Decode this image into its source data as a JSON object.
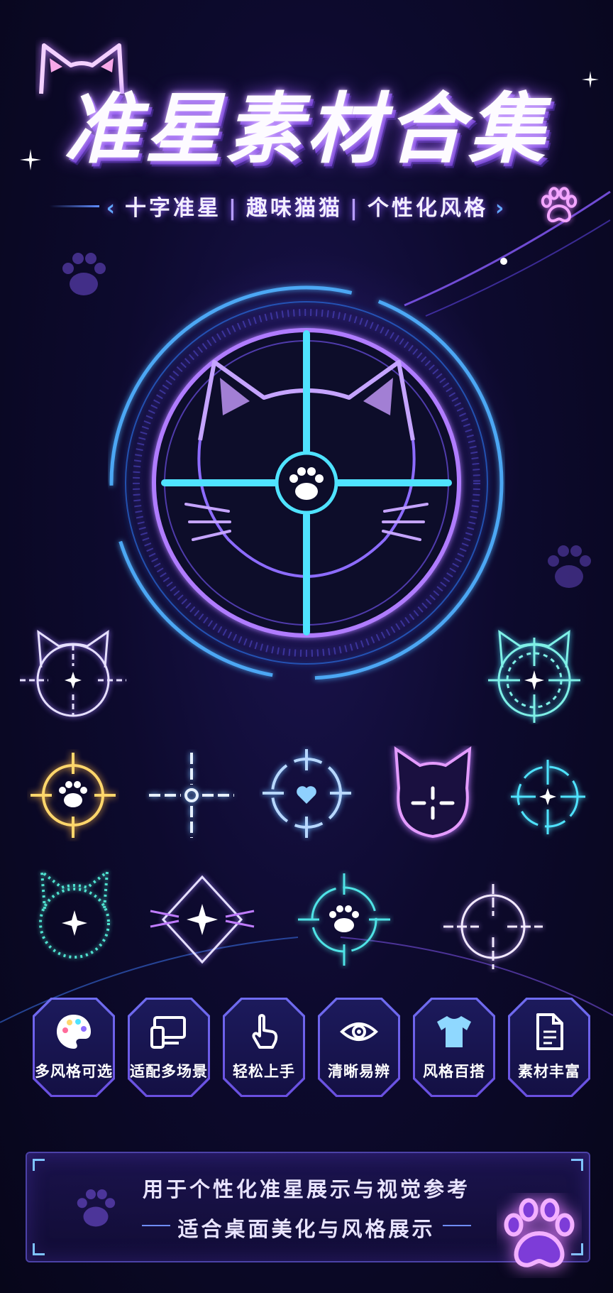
{
  "title": "准星素材合集",
  "subtitle": {
    "items": [
      "十字准星",
      "趣味猫猫",
      "个性化风格"
    ],
    "separator": "|",
    "left_arrow": "‹",
    "right_arrow": "›"
  },
  "features": [
    {
      "label": "多风格可选",
      "icon": "palette-icon"
    },
    {
      "label": "适配多场景",
      "icon": "devices-icon"
    },
    {
      "label": "轻松上手",
      "icon": "pointer-hand-icon"
    },
    {
      "label": "清晰易辨",
      "icon": "eye-icon"
    },
    {
      "label": "风格百搭",
      "icon": "tshirt-icon"
    },
    {
      "label": "素材丰富",
      "icon": "document-icon"
    }
  ],
  "footer": {
    "line1": "用于个性化准星展示与视觉参考",
    "line2": "适合桌面美化与风格展示"
  },
  "colors": {
    "cyan": "#4fe3ff",
    "purple": "#b07cff",
    "pink": "#e79bff",
    "gold": "#ffd66b",
    "background": "#0d0a2e"
  }
}
